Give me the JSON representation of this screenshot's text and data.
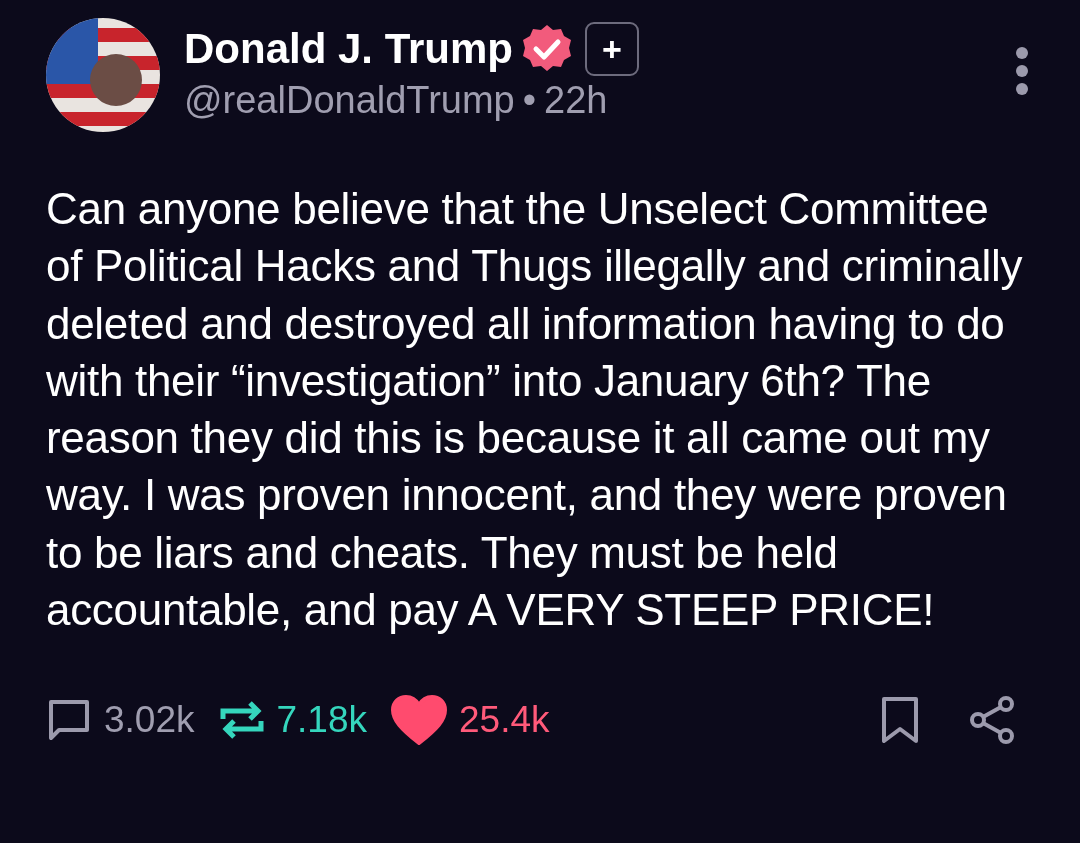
{
  "post": {
    "author": {
      "name": "Donald J. Trump",
      "verified": true,
      "handle": "@realDonaldTrump",
      "separator": "•",
      "time": "22h"
    },
    "follow_button": {
      "label": "+"
    },
    "text": "Can anyone believe that the Unselect Committee of Political Hacks and Thugs illegally and criminally deleted and destroyed all information having to do with their “investigation” into January 6th? The reason they did this is because it all came out my way. I was proven innocent, and they were proven to be liars and cheats. They must be held accountable, and pay A VERY STEEP PRICE!",
    "actions": {
      "replies": "3.02k",
      "reposts": "7.18k",
      "reposted": true,
      "likes": "25.4k",
      "liked": true
    }
  }
}
